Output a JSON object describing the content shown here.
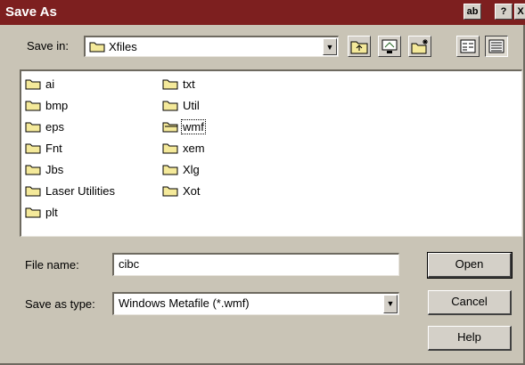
{
  "dialog": {
    "title": "Save As",
    "titlebar_buttons": [
      {
        "label": "ab"
      },
      {
        "label": "?"
      },
      {
        "label": "X"
      }
    ]
  },
  "save_in": {
    "label": "Save in:",
    "value": "Xfiles"
  },
  "toolbar": {
    "icons": [
      "up-one-level-icon",
      "desktop-icon",
      "create-new-folder-icon",
      "list-view-icon",
      "details-view-icon"
    ]
  },
  "files": {
    "column1": [
      {
        "label": "ai"
      },
      {
        "label": "bmp"
      },
      {
        "label": "eps"
      },
      {
        "label": "Fnt"
      },
      {
        "label": "Jbs"
      },
      {
        "label": "Laser Utilities"
      },
      {
        "label": "plt"
      }
    ],
    "column2": [
      {
        "label": "txt"
      },
      {
        "label": "Util"
      },
      {
        "label": "wmf"
      },
      {
        "label": "xem"
      },
      {
        "label": "Xlg"
      },
      {
        "label": "Xot"
      }
    ],
    "selected": "wmf"
  },
  "file_name": {
    "label": "File name:",
    "value": "cibc"
  },
  "save_as_type": {
    "label": "Save as type:",
    "value": "Windows Metafile (*.wmf)"
  },
  "buttons": {
    "open": "Open",
    "cancel": "Cancel",
    "help": "Help"
  },
  "colors": {
    "titlebar": "#7d1f1f",
    "dialog_face": "#c9c4b6",
    "folder": "#f4e99a"
  }
}
